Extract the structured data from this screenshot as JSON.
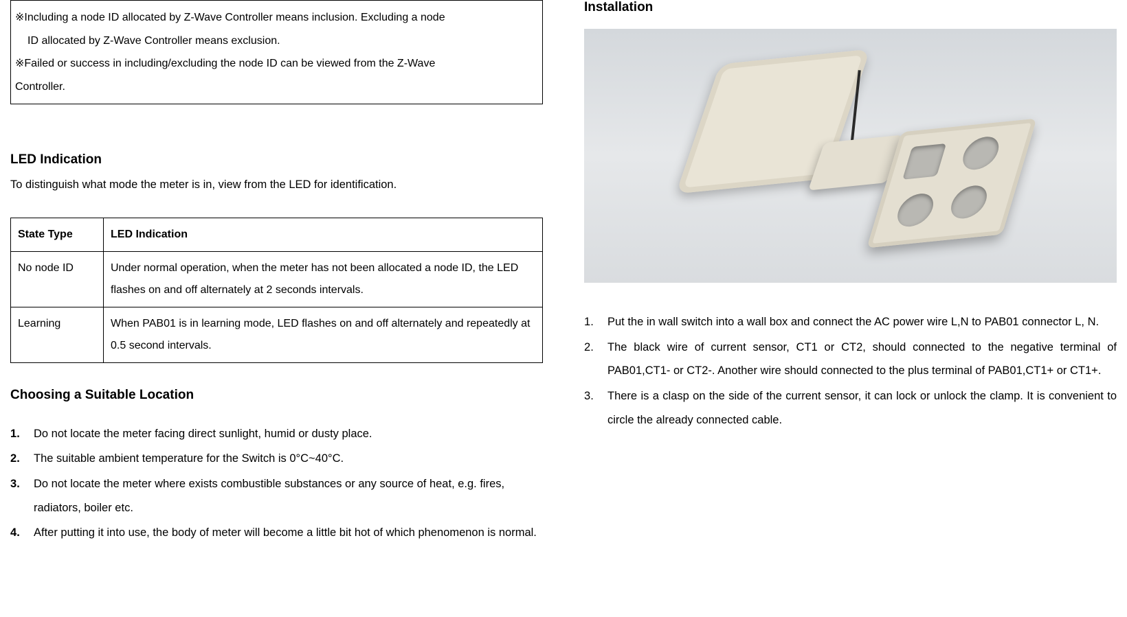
{
  "noteBox": {
    "line1a": "※Including a node ID allocated by Z-Wave Controller means inclusion.  Excluding a node",
    "line1b": "ID allocated by Z-Wave Controller means exclusion.",
    "line2a": "※Failed or success in including/excluding the node ID can be viewed from the Z-Wave",
    "line2b": "Controller."
  },
  "led": {
    "heading": "LED Indication",
    "intro": "To distinguish what mode the meter is in, view from the LED for identification.",
    "table": {
      "head": {
        "c1": "State Type",
        "c2": "LED Indication"
      },
      "rows": [
        {
          "c1": "No node ID",
          "c2": "Under normal operation, when the meter has not been allocated a node ID, the LED flashes on and off alternately at 2 seconds intervals."
        },
        {
          "c1": "Learning",
          "c2": "When PAB01 is in learning mode, LED flashes on and off alternately and repeatedly at 0.5 second intervals."
        }
      ]
    }
  },
  "location": {
    "heading": "Choosing a Suitable Location",
    "items": [
      "Do not locate the meter facing direct sunlight, humid or dusty place.",
      "The suitable ambient temperature for the Switch is 0°C~40°C.",
      "Do not locate the meter where exists combustible substances or any source of heat, e.g. fires, radiators, boiler etc.",
      "After putting it into use, the body of meter will become a little bit hot of which phenomenon is normal."
    ]
  },
  "installation": {
    "heading": "Installation",
    "items": [
      "Put the in wall switch into a wall box and connect the AC power wire L,N to PAB01 connector L, N.",
      "The black wire of current sensor, CT1 or CT2, should connected to the negative terminal of PAB01,CT1- or CT2-. Another wire should connected to the plus terminal of PAB01,CT1+ or CT1+.",
      "There is a clasp on the side of the current sensor, it can lock or unlock the clamp. It is convenient to circle the already connected cable."
    ]
  }
}
